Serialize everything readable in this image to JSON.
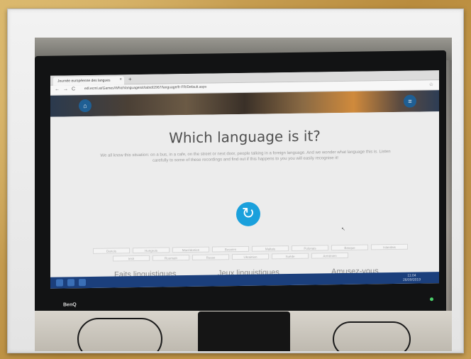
{
  "browser": {
    "tab_title": "Journée européenne des langues",
    "tab_close": "×",
    "new_tab": "+",
    "back": "←",
    "forward": "→",
    "reload": "C",
    "url": "edl.ecml.at/Games/Whichlanguageisit/tabid/2967/language/fr-FR/Default.aspx",
    "bookmark": "☆"
  },
  "page": {
    "title": "Which language is it?",
    "description": "We all know this situation: on a bus, in a cafe, on the street or next door, people talking in a foreign language. And we wonder what language this is. Listen carefully to some of these recordings and find out if this happens to you you will easily recognise it!",
    "refresh_glyph": "↻",
    "home_glyph": "⌂",
    "menu_glyph": "≡",
    "cursor_glyph": "↖",
    "languages_row1": [
      "Danois",
      "Hongrois",
      "Macédonien",
      "Bosnien",
      "Maltais",
      "Polonais",
      "Basque",
      "Islandais"
    ],
    "languages_row2": [
      "Irish",
      "Roumain",
      "Russe",
      "Ukrainien",
      "Suède",
      "Arménien"
    ],
    "footer_links": [
      "Faits linguistiques",
      "Jeux linguistiques",
      "Amusez-vous"
    ]
  },
  "taskbar": {
    "clock_time": "11:04",
    "clock_date": "26/09/2019"
  },
  "monitor": {
    "brand": "BenQ"
  },
  "colors": {
    "accent": "#1aa0dc",
    "taskbar": "#1b3f7c",
    "title": "#505050"
  }
}
